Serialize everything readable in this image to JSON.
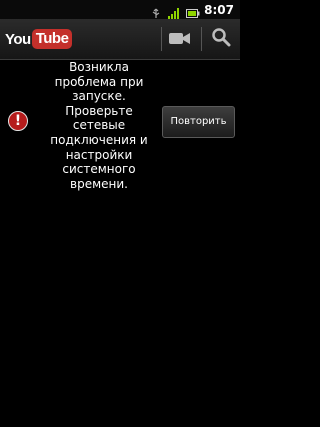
{
  "status_bar": {
    "time": "8:07",
    "icons": [
      "usb-icon",
      "signal-icon",
      "battery-icon"
    ]
  },
  "app_bar": {
    "logo": {
      "you": "You",
      "tube": "Tube"
    },
    "actions": [
      "camera-icon",
      "search-icon"
    ],
    "brand_color": "#c4302b"
  },
  "error": {
    "icon": "error-icon",
    "icon_glyph": "!",
    "message": "Возникла\nпроблема при\nзапуске.\nПроверьте\nсетевые\nподключения и\nнастройки\nсистемного\nвремени.",
    "retry_label": "Повторить"
  }
}
